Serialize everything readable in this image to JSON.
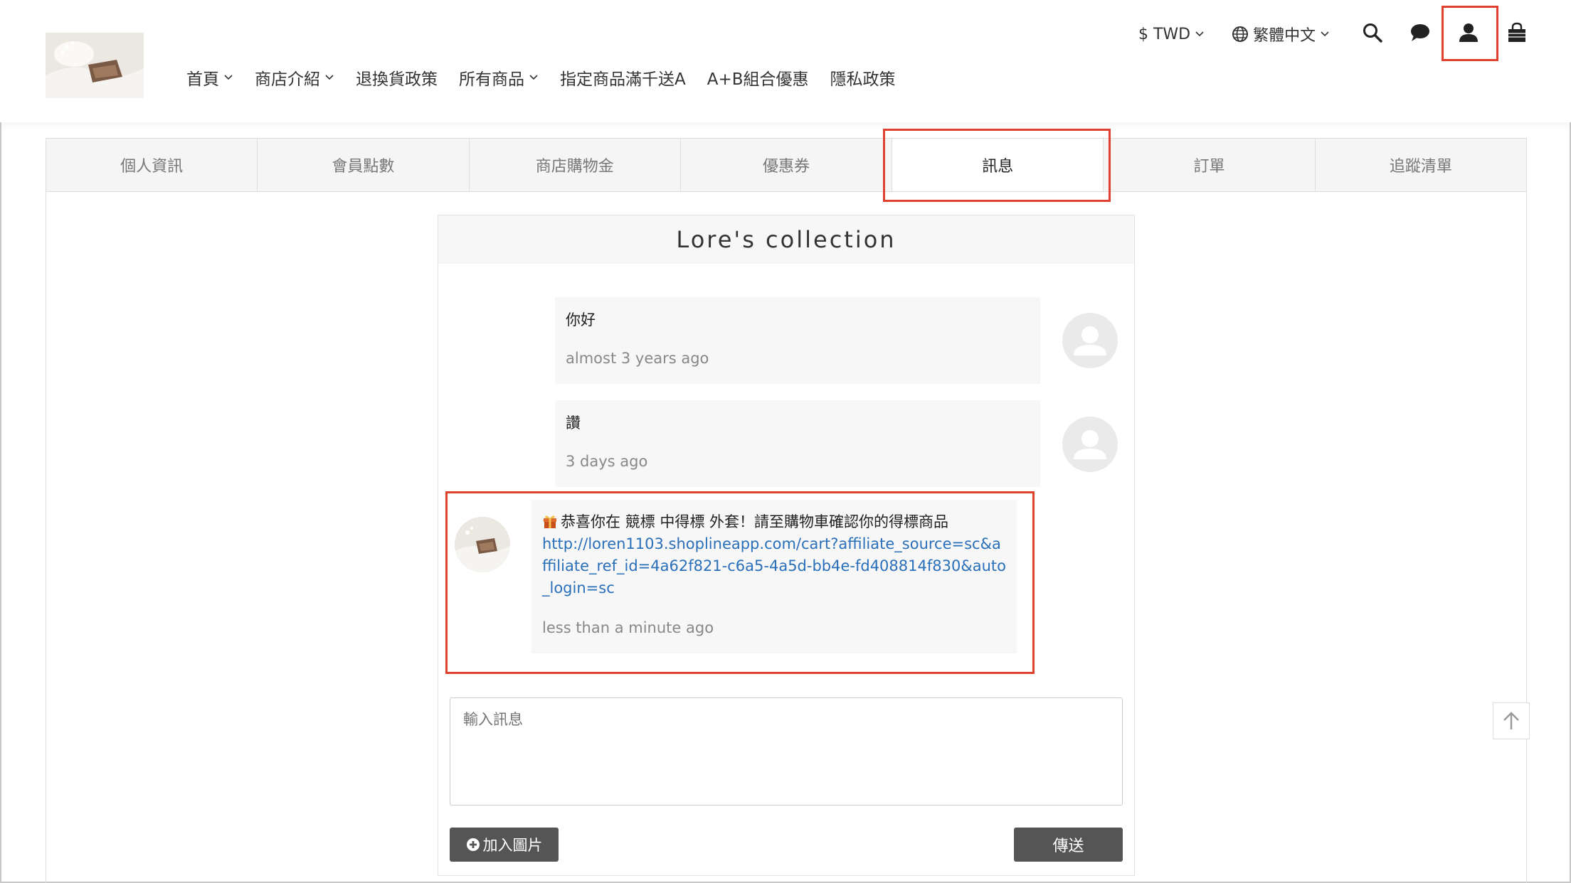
{
  "header": {
    "nav": [
      {
        "label": "首頁",
        "has_dropdown": true
      },
      {
        "label": "商店介紹",
        "has_dropdown": true
      },
      {
        "label": "退換貨政策",
        "has_dropdown": false
      },
      {
        "label": "所有商品",
        "has_dropdown": true
      },
      {
        "label": "指定商品滿千送A",
        "has_dropdown": false
      },
      {
        "label": "A+B組合優惠",
        "has_dropdown": false
      },
      {
        "label": "隱私政策",
        "has_dropdown": false
      }
    ],
    "currency": "$ TWD",
    "language": "繁體中文",
    "icons": [
      "search-icon",
      "chat-icon",
      "user-icon",
      "shopping-bag-icon"
    ]
  },
  "tabs": [
    {
      "label": "個人資訊",
      "active": false
    },
    {
      "label": "會員點數",
      "active": false
    },
    {
      "label": "商店購物金",
      "active": false
    },
    {
      "label": "優惠券",
      "active": false
    },
    {
      "label": "訊息",
      "active": true
    },
    {
      "label": "訂單",
      "active": false
    },
    {
      "label": "追蹤清單",
      "active": false
    }
  ],
  "chat": {
    "title": "Lore's collection",
    "messages": [
      {
        "from": "user",
        "text": "你好",
        "time": "almost 3 years ago"
      },
      {
        "from": "user",
        "text": "讚",
        "time": "3 days ago"
      },
      {
        "from": "shop",
        "text": "恭喜你在 競標 中得標 外套！請至購物車確認你的得標商品",
        "link": "http://loren1103.shoplineapp.com/cart?affiliate_source=sc&affiliate_ref_id=4a62f821-c6a5-4a5d-bb4e-fd408814f830&auto_login=sc",
        "time": "less than a minute ago"
      }
    ],
    "input_placeholder": "輸入訊息",
    "add_image_label": "加入圖片",
    "send_label": "傳送"
  },
  "colors": {
    "highlight": "#e0412f",
    "link": "#2a6fba",
    "button": "#555555"
  }
}
